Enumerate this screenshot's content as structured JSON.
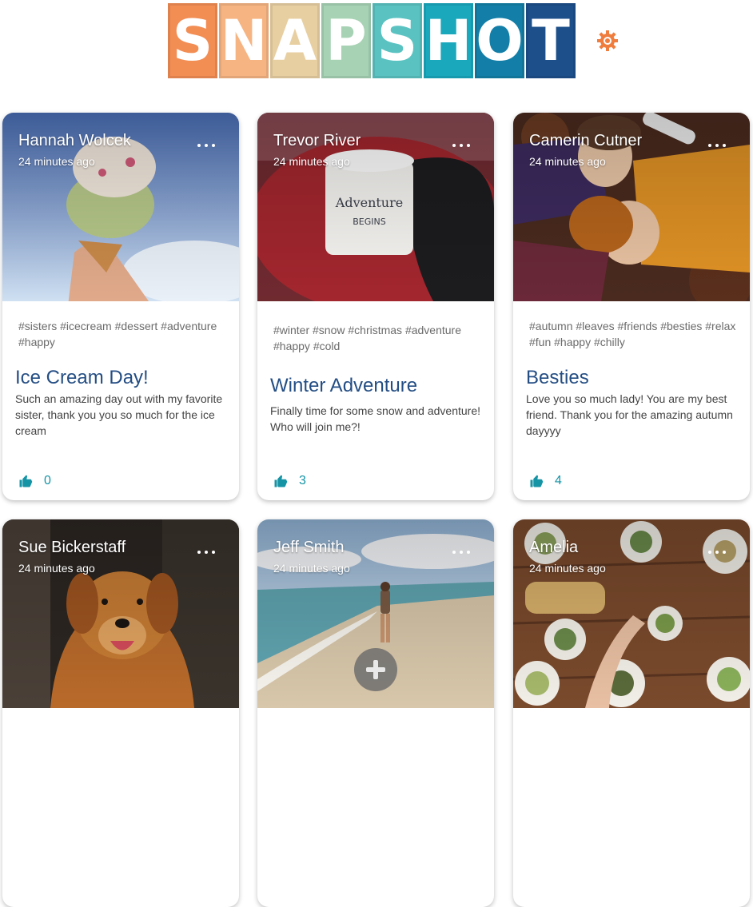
{
  "header": {
    "logo_letters": [
      "S",
      "N",
      "A",
      "P",
      "S",
      "H",
      "O",
      "T"
    ],
    "logo_colors": [
      "#f28d54",
      "#f6b482",
      "#e8cfa2",
      "#a7d2b4",
      "#5ac3c2",
      "#1aa8bd",
      "#137fa8",
      "#1d4f8a"
    ],
    "settings_icon": "gear-icon",
    "settings_color": "#ef7d3d"
  },
  "colors": {
    "title": "#244e84",
    "accent": "#1594a6"
  },
  "posts": [
    {
      "author": "Hannah Wolcek",
      "time": "24 minutes ago",
      "tags": "#sisters #icecream #dessert #adventure #happy",
      "title": "Ice Cream Day!",
      "message": "Such an amazing day out with my favorite sister, thank you you so much for the ice cream",
      "likes": "0"
    },
    {
      "author": "Trevor River",
      "time": "24 minutes ago",
      "tags": "#winter #snow #christmas #adventure #happy #cold",
      "title": "Winter Adventure",
      "message": "Finally time for some snow and adventure! Who will join me?!",
      "likes": "3"
    },
    {
      "author": "Camerin Cutner",
      "time": "24 minutes ago",
      "tags": "#autumn #leaves #friends #besties #relax #fun #happy #chilly",
      "title": "Besties",
      "message": "Love you so much lady! You are my best friend. Thank you for the amazing autumn dayyyy",
      "likes": "4"
    },
    {
      "author": "Sue Bickerstaff",
      "time": "24 minutes ago"
    },
    {
      "author": "Jeff Smith",
      "time": "24 minutes ago"
    },
    {
      "author": "Amelia",
      "time": "24 minutes ago"
    }
  ],
  "fab": {
    "icon": "plus-icon"
  }
}
